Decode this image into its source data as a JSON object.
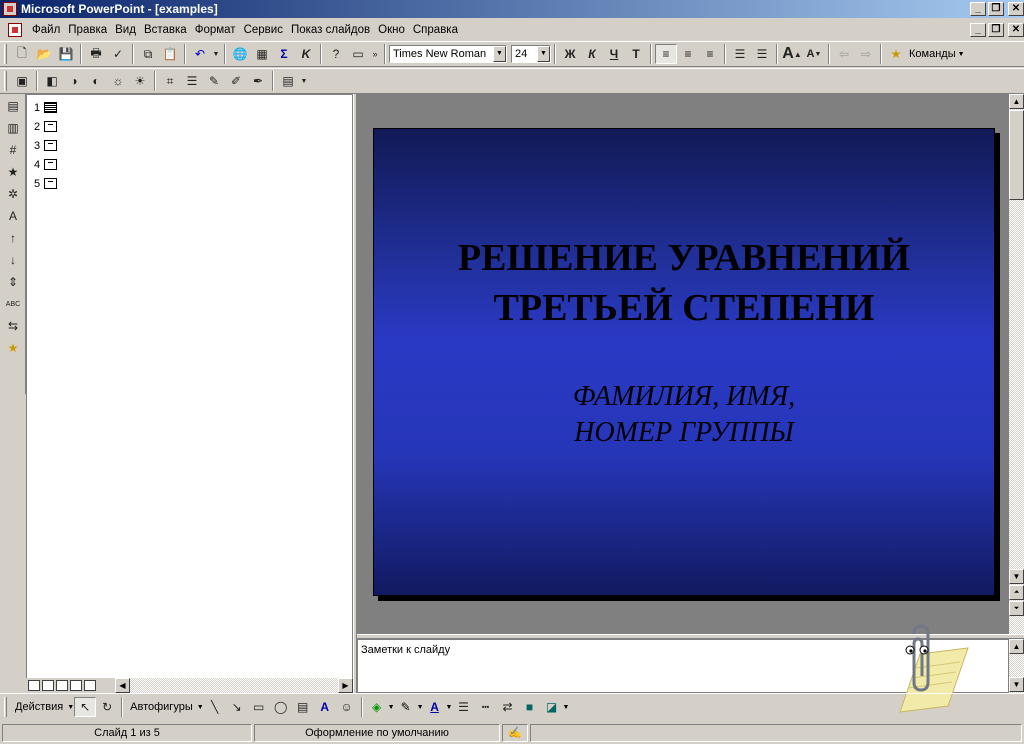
{
  "window": {
    "title": "Microsoft PowerPoint - [examples]"
  },
  "menu": [
    "Файл",
    "Правка",
    "Вид",
    "Вставка",
    "Формат",
    "Сервис",
    "Показ слайдов",
    "Окно",
    "Справка"
  ],
  "format_toolbar": {
    "font": "Times New Roman",
    "size": "24",
    "commands_label": "Команды"
  },
  "outline": {
    "slides": [
      "1",
      "2",
      "3",
      "4",
      "5"
    ],
    "selected": 0
  },
  "slide": {
    "title_line1": "РЕШЕНИЕ УРАВНЕНИЙ",
    "title_line2": "ТРЕТЬЕЙ СТЕПЕНИ",
    "subtitle_line1": "ФАМИЛИЯ, ИМЯ,",
    "subtitle_line2": "НОМЕР ГРУППЫ"
  },
  "notes": {
    "text": "Заметки к слайду"
  },
  "draw_toolbar": {
    "actions_label": "Действия",
    "autoshapes_label": "Автофигуры"
  },
  "status": {
    "slide_info": "Слайд 1 из 5",
    "design": "Оформление по умолчанию"
  },
  "colors": {
    "titlebar_start": "#0a246a",
    "slide_mid": "#2a39c4",
    "slide_dark": "#111a55"
  }
}
